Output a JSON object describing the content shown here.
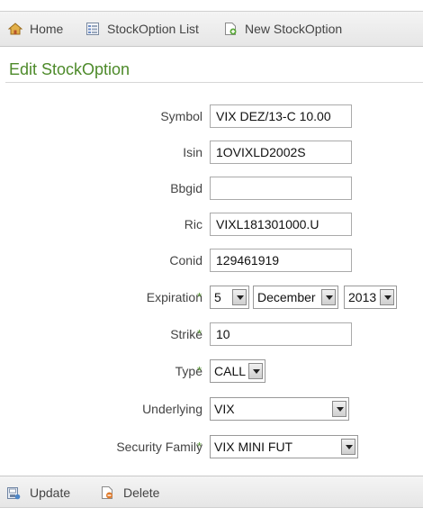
{
  "nav": {
    "home": "Home",
    "list": "StockOption List",
    "new": "New StockOption"
  },
  "page_title": "Edit StockOption",
  "form": {
    "symbol": {
      "label": "Symbol",
      "value": "VIX DEZ/13-C 10.00"
    },
    "isin": {
      "label": "Isin",
      "value": "1OVIXLD2002S"
    },
    "bbgid": {
      "label": "Bbgid",
      "value": ""
    },
    "ric": {
      "label": "Ric",
      "value": "VIXL181301000.U"
    },
    "conid": {
      "label": "Conid",
      "value": "129461919"
    },
    "expiration": {
      "label": "Expiration",
      "required": "*",
      "day": "5",
      "month": "December",
      "year": "2013"
    },
    "strike": {
      "label": "Strike",
      "required": "*",
      "value": "10"
    },
    "type": {
      "label": "Type",
      "required": "*",
      "value": "CALL"
    },
    "underlying": {
      "label": "Underlying",
      "value": "VIX"
    },
    "security_family": {
      "label": "Security Family",
      "required": "*",
      "value": "VIX MINI FUT"
    }
  },
  "actions": {
    "update": "Update",
    "delete": "Delete"
  },
  "colors": {
    "accent": "#4d8a2a"
  }
}
